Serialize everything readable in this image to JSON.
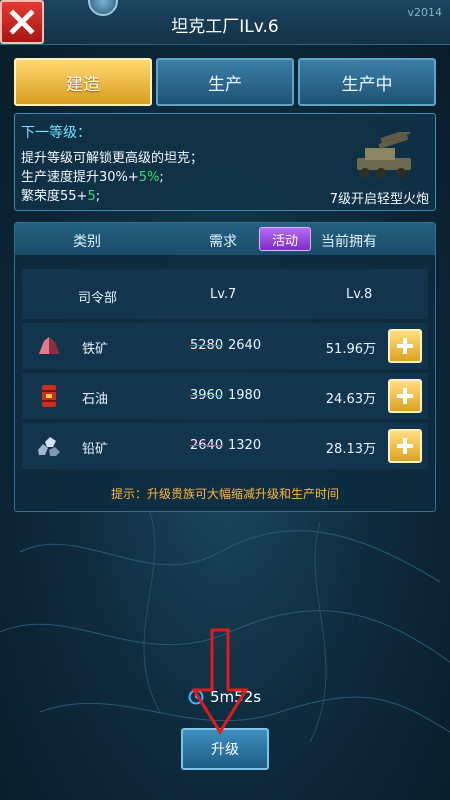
{
  "header": {
    "title": "坦克工厂ILv.6",
    "version": "v2014"
  },
  "tabs": [
    {
      "label": "建造",
      "active": true
    },
    {
      "label": "生产",
      "active": false
    },
    {
      "label": "生产中",
      "active": false
    }
  ],
  "info": {
    "heading": "下一等级：",
    "line1": "提升等级可解锁更高级的坦克；",
    "line2_prefix": "生产速度提升30%+",
    "line2_bonus": "5%",
    "line2_suffix": ";",
    "line3_prefix": "繁荣度55+",
    "line3_bonus": "5",
    "line3_suffix": ";",
    "unlock_text": "7级开启轻型火炮"
  },
  "table": {
    "headers": {
      "category": "类别",
      "requirement": "需求",
      "badge": "活动",
      "owned": "当前拥有"
    },
    "level_row": {
      "name": "司令部",
      "required": "Lv.7",
      "owned": "Lv.8"
    },
    "rows": [
      {
        "name": "铁矿",
        "old": "5280",
        "new": "2640",
        "owned": "51.96万",
        "icon": "iron-ore-icon"
      },
      {
        "name": "石油",
        "old": "3960",
        "new": "1980",
        "owned": "24.63万",
        "icon": "oil-barrel-icon"
      },
      {
        "name": "铅矿",
        "old": "2640",
        "new": "1320",
        "owned": "28.13万",
        "icon": "lead-ore-icon"
      }
    ],
    "tip": "提示：升级贵族可大幅缩减升级和生产时间"
  },
  "footer": {
    "time": "5m52s",
    "upgrade_label": "升级"
  },
  "colors": {
    "accent_gold": "#f2b93a",
    "bonus_green": "#46d86a",
    "tip_orange": "#ffb640",
    "badge_purple": "#9a3fdc",
    "close_red": "#d9302a"
  }
}
